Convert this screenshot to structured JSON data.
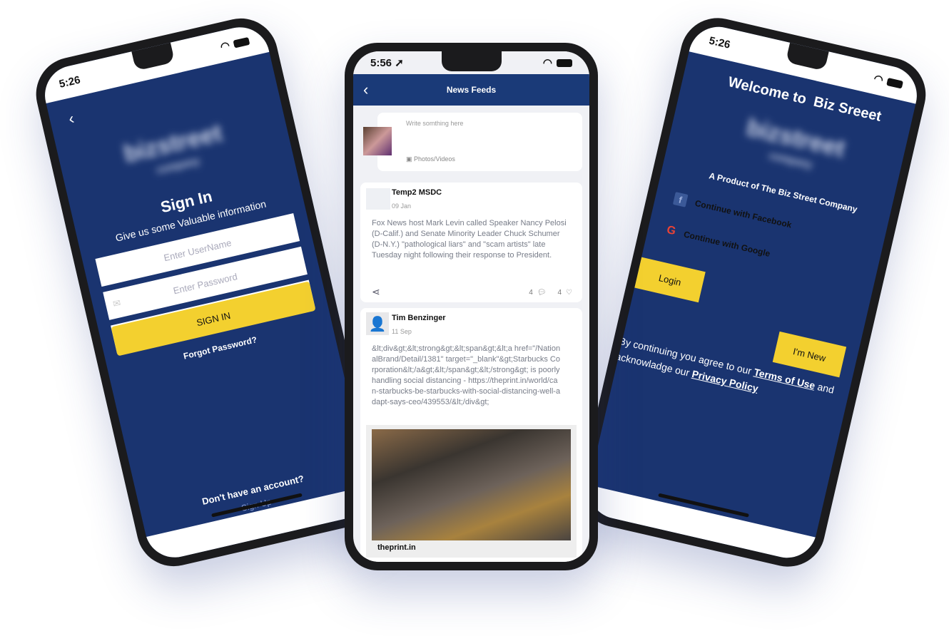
{
  "signin": {
    "time": "5:26",
    "title": "Sign In",
    "subtitle": "Give us some Valuable information",
    "logo": "bizstreet",
    "logo_sub": "company",
    "username_placeholder": "Enter UserName",
    "password_placeholder": "Enter Password",
    "signin_button": "SIGN IN",
    "forgot": "Forgot Password?",
    "no_account": "Don't have an account?",
    "signup": "Sign Up"
  },
  "feed": {
    "time": "5:56",
    "title": "News Feeds",
    "composer_placeholder": "Write somthing here",
    "photos_label": "Photos/Videos",
    "posts": [
      {
        "author": "Temp2 MSDC",
        "date": "09 Jan",
        "text": "Fox News host Mark Levin called Speaker Nancy Pelosi (D-Calif.) and Senate Minority Leader Chuck Schumer (D-N.Y.) \"pathological liars\" and \"scam artists\" late Tuesday night following their response to President.",
        "comments": "4",
        "likes": "4"
      },
      {
        "author": "Tim Benzinger",
        "date": "11 Sep",
        "text": "&lt;div&gt;&lt;strong&gt;&lt;span&gt;&lt;a href=\"/NationalBrand/Detail/1381\" target=\"_blank\"&gt;Starbucks Corporation&lt;/a&gt;&lt;/span&gt;&lt;/strong&gt; is poorly handling social distancing - https://theprint.in/world/can-starbucks-be-starbucks-with-social-distancing-well-adapt-says-ceo/439553/&lt;/div&gt;",
        "link_source": "theprint.in"
      }
    ]
  },
  "welcome": {
    "time": "5:26",
    "title": "Welcome to  Biz Sreeet",
    "logo": "bizstreet",
    "logo_sub": "company",
    "product": "A Product of The Biz Street Company",
    "facebook": "Continue with Facebook",
    "google": "Continue with Google",
    "login": "Login",
    "new": "I'm New",
    "terms_prefix": "By continuing you agree to our",
    "terms": "Terms of Use",
    "and": "and",
    "ack": "acknowladge our",
    "privacy": "Privacy Policy"
  },
  "colors": {
    "brand_blue": "#1a3470",
    "accent_yellow": "#f3d02f"
  }
}
